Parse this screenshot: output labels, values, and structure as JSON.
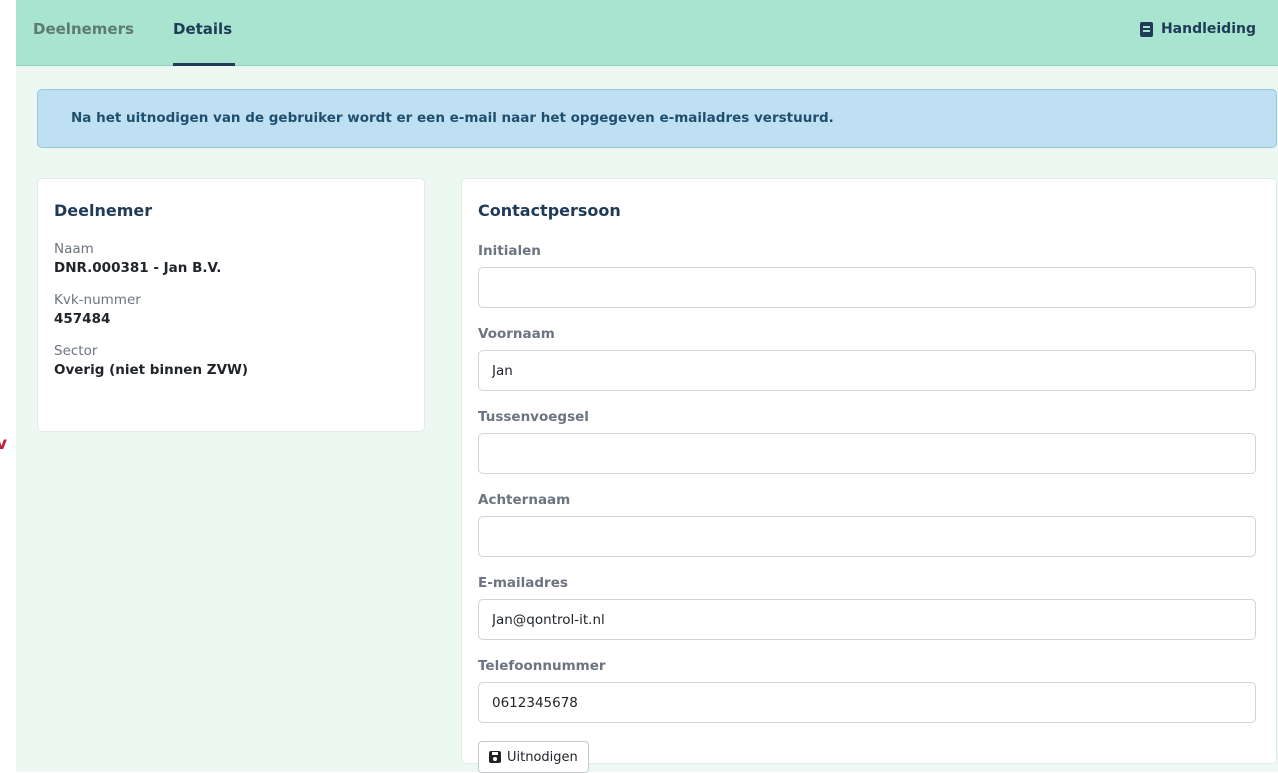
{
  "side_fragment": {
    "text": "v"
  },
  "nav": {
    "tabs": [
      {
        "label": "Deelnemers",
        "active": false
      },
      {
        "label": "Details",
        "active": true
      }
    ],
    "manual": {
      "label": "Handleiding",
      "icon": "book-icon"
    }
  },
  "alert": {
    "text": "Na het uitnodigen van de gebruiker wordt er een e-mail naar het opgegeven e-mailadres verstuurd."
  },
  "participant": {
    "title": "Deelnemer",
    "fields": [
      {
        "label": "Naam",
        "value": "DNR.000381 - Jan B.V."
      },
      {
        "label": "Kvk-nummer",
        "value": "457484"
      },
      {
        "label": "Sector",
        "value": "Overig (niet binnen ZVW)"
      }
    ]
  },
  "contact": {
    "title": "Contactpersoon",
    "fields": [
      {
        "label": "Initialen",
        "value": ""
      },
      {
        "label": "Voornaam",
        "value": "Jan"
      },
      {
        "label": "Tussenvoegsel",
        "value": ""
      },
      {
        "label": "Achternaam",
        "value": ""
      },
      {
        "label": "E-mailadres",
        "value": "Jan@qontrol-it.nl"
      },
      {
        "label": "Telefoonnummer",
        "value": "0612345678"
      }
    ],
    "submit": {
      "label": "Uitnodigen",
      "icon": "save-icon"
    }
  },
  "colors": {
    "topbar": "#a8e4d0",
    "page_background": "#eef8f3",
    "alert_background": "#bfe0f2",
    "heading": "#1f3b57",
    "side_fragment": "#c0203a"
  }
}
